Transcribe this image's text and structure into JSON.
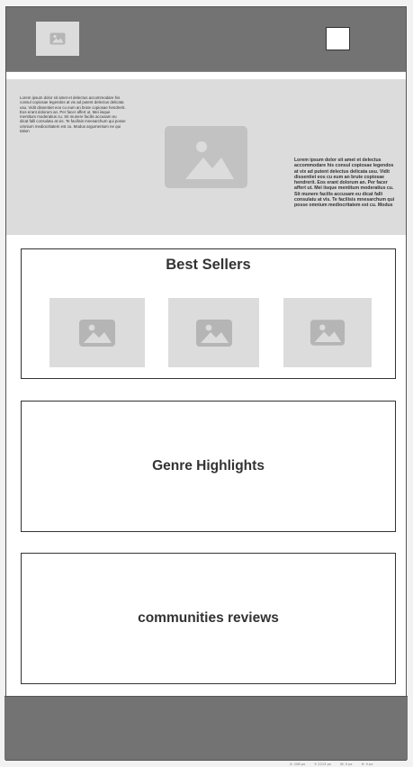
{
  "hero": {
    "left_text": "Lorem ipsum dolor sit amet et delectus accommodare his consul copiosae legendos at vix ad putent delectus delicata usu. Vidit dissentiet eos cu eum an brute copiosae hendrerit. Eos erant dolorum an. Per facer affert ut. Mei iisque mentitum moderatius cu. Sit munere facilis accusam eu dicat falli consulatu at vis. Te facilisis mnesarchum qui posse omnium mediocritatem est cu. Modus argumentum ne qui tation",
    "right_text": "Lorem ipsum dolor sit amet et delectus accommodare his consul copiosae legendos at vix ad putent delectus delicata usu. Vidit dissentiet eos cu eum an brute copiosae hendrerit. Eos erant dolorum an. Per facer affert ut. Mei iisque mentitum moderatius cu. Sit munere facilis accusam eu dicat falli consulatu at vis. Te facilisis mnesarchum qui posse omnium mediocritatem est cu. Modus"
  },
  "sections": {
    "best_sellers": "Best Sellers",
    "genre_highlights": "Genre Highlights",
    "community_reviews": "communities reviews"
  },
  "status": {
    "x": "X: 108 px",
    "y": "Y: 2213 px",
    "w": "W: 0 px",
    "h": "H: 0 px"
  },
  "colors": {
    "header": "#737373",
    "placeholder": "#dcdcdc",
    "image_glyph": "#b5b5b5"
  }
}
